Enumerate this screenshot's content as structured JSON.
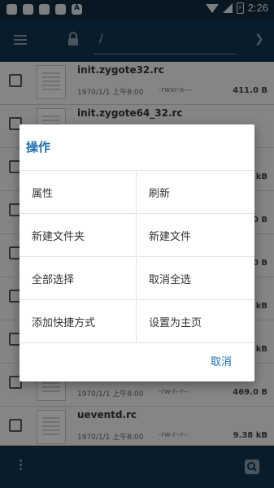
{
  "status_bar": {
    "time": "2:26",
    "battery_glyph": "⚡"
  },
  "toolbar": {
    "path": "/"
  },
  "files": [
    {
      "name": "init.zygote32.rc",
      "date": "1970/1/1 上午8:00",
      "perms": "-rwxr-x---",
      "size": "411.0 B"
    },
    {
      "name": "init.zygote64_32.rc",
      "date": "",
      "perms": "",
      "size": ""
    },
    {
      "name": "",
      "date": "",
      "perms": "",
      "size": "kB"
    },
    {
      "name": "",
      "date": "",
      "perms": "",
      "size": "0 B"
    },
    {
      "name": "",
      "date": "",
      "perms": "",
      "size": "0 B"
    },
    {
      "name": "",
      "date": "",
      "perms": "",
      "size": "kB"
    },
    {
      "name": "",
      "date": "",
      "perms": "",
      "size": "kB"
    },
    {
      "name": "",
      "date": "1970/1/1 上午8:00",
      "perms": "-rw-r--r--",
      "size": "469.0 B"
    },
    {
      "name": "ueventd.rc",
      "date": "1970/1/1 上午8:00",
      "perms": "-rw-r--r--",
      "size": "9.38 kB"
    }
  ],
  "dialog": {
    "title": "操作",
    "options": [
      [
        "属性",
        "刷新"
      ],
      [
        "新建文件夹",
        "新建文件"
      ],
      [
        "全部选择",
        "取消全选"
      ],
      [
        "添加快捷方式",
        "设置为主页"
      ]
    ],
    "cancel_label": "取消"
  }
}
